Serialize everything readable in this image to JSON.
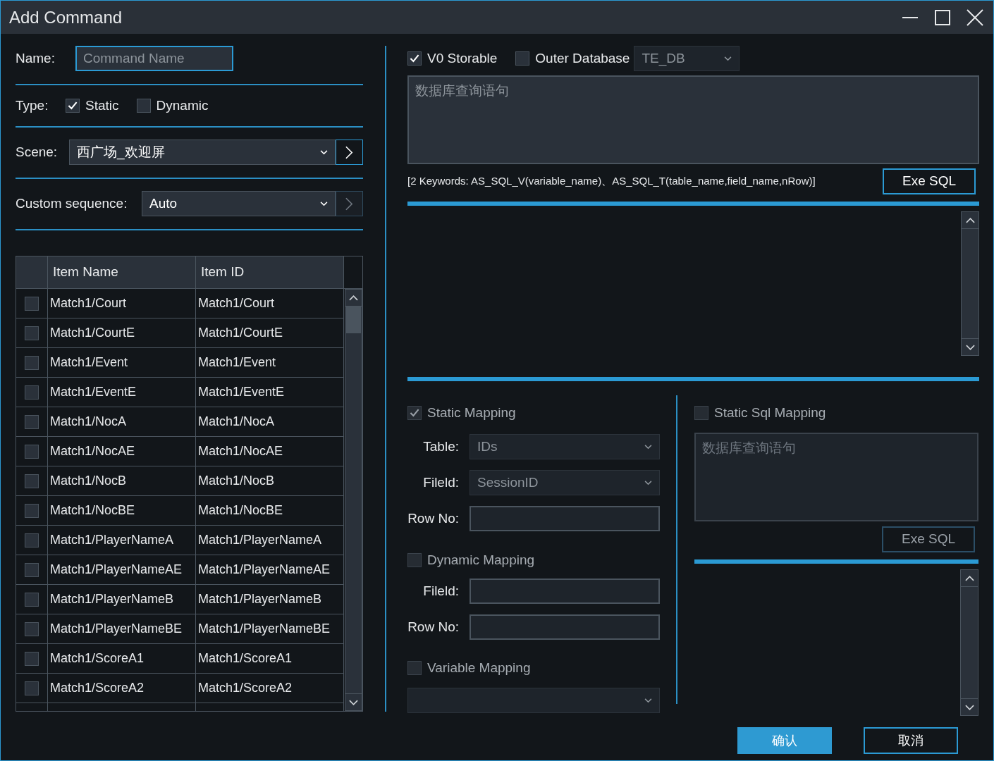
{
  "window": {
    "title": "Add Command"
  },
  "name": {
    "label": "Name:",
    "placeholder": "Command Name"
  },
  "type": {
    "label": "Type:",
    "options": [
      {
        "label": "Static",
        "checked": true
      },
      {
        "label": "Dynamic",
        "checked": false
      }
    ]
  },
  "scene": {
    "label": "Scene:",
    "value": "西广场_欢迎屏"
  },
  "custom_sequence": {
    "label": "Custom sequence:",
    "value": "Auto"
  },
  "table": {
    "columns": [
      "Item Name",
      "Item ID"
    ],
    "rows": [
      {
        "cells": [
          "Match1/Court",
          "Match1/Court"
        ],
        "checked": false
      },
      {
        "cells": [
          "Match1/CourtE",
          "Match1/CourtE"
        ],
        "checked": false
      },
      {
        "cells": [
          "Match1/Event",
          "Match1/Event"
        ],
        "checked": false
      },
      {
        "cells": [
          "Match1/EventE",
          "Match1/EventE"
        ],
        "checked": false
      },
      {
        "cells": [
          "Match1/NocA",
          "Match1/NocA"
        ],
        "checked": false
      },
      {
        "cells": [
          "Match1/NocAE",
          "Match1/NocAE"
        ],
        "checked": false
      },
      {
        "cells": [
          "Match1/NocB",
          "Match1/NocB"
        ],
        "checked": false
      },
      {
        "cells": [
          "Match1/NocBE",
          "Match1/NocBE"
        ],
        "checked": false
      },
      {
        "cells": [
          "Match1/PlayerNameA",
          "Match1/PlayerNameA"
        ],
        "checked": false
      },
      {
        "cells": [
          "Match1/PlayerNameAE",
          "Match1/PlayerNameAE"
        ],
        "checked": false
      },
      {
        "cells": [
          "Match1/PlayerNameB",
          "Match1/PlayerNameB"
        ],
        "checked": false
      },
      {
        "cells": [
          "Match1/PlayerNameBE",
          "Match1/PlayerNameBE"
        ],
        "checked": false
      },
      {
        "cells": [
          "Match1/ScoreA1",
          "Match1/ScoreA1"
        ],
        "checked": false
      },
      {
        "cells": [
          "Match1/ScoreA2",
          "Match1/ScoreA2"
        ],
        "checked": false
      }
    ]
  },
  "sql": {
    "v0_storable": {
      "label": "V0 Storable",
      "checked": true
    },
    "outer_database": {
      "label": "Outer Database",
      "checked": false
    },
    "database": {
      "value": "TE_DB",
      "disabled": true
    },
    "query": {
      "placeholder": "数据库查询语句"
    },
    "keywords": "[2 Keywords: AS_SQL_V(variable_name)、AS_SQL_T(table_name,field_name,nRow)]",
    "exe_button": {
      "label": "Exe SQL",
      "disabled": false
    }
  },
  "static_mapping": {
    "label": "Static Mapping",
    "checked": true,
    "disabled": true,
    "fields": [
      {
        "kind": "select",
        "label": "Table:",
        "value": "IDs"
      },
      {
        "kind": "select",
        "label": "Fileld:",
        "value": "SessionID"
      },
      {
        "kind": "input",
        "label": "Row No:"
      }
    ]
  },
  "dynamic_mapping": {
    "label": "Dynamic Mapping",
    "checked": false,
    "disabled": true,
    "fields": [
      {
        "kind": "input",
        "label": "Fileld:"
      },
      {
        "kind": "input",
        "label": "Row No:"
      }
    ]
  },
  "variable_mapping": {
    "label": "Variable Mapping",
    "checked": false,
    "disabled": true
  },
  "static_sql_mapping": {
    "label": "Static Sql Mapping",
    "checked": false,
    "disabled": true,
    "query": {
      "placeholder": "数据库查询语句"
    },
    "exe_button": {
      "label": "Exe SQL",
      "disabled": true
    }
  },
  "buttons": [
    {
      "label": "确认",
      "kind": "primary"
    },
    {
      "label": "取消",
      "kind": "secondary"
    }
  ]
}
